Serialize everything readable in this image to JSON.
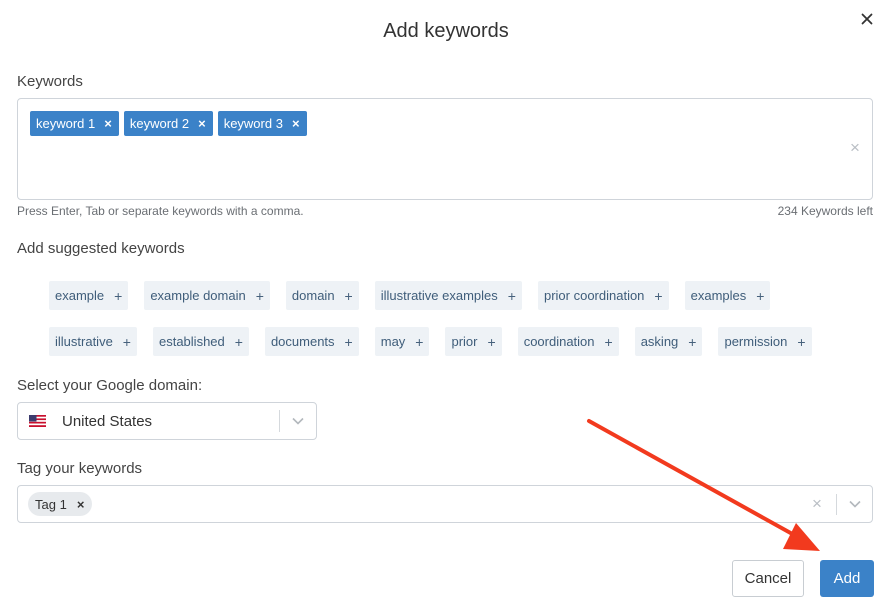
{
  "dialog": {
    "title": "Add keywords",
    "close_icon": "close-icon"
  },
  "keywords": {
    "label": "Keywords",
    "tags": [
      "keyword 1",
      "keyword 2",
      "keyword 3"
    ],
    "remove_glyph": "×",
    "clear_glyph": "×",
    "hint": "Press Enter, Tab or separate keywords with a comma.",
    "left_count": "234 Keywords left",
    "tag_color": "#3b82c8"
  },
  "suggested": {
    "label": "Add suggested keywords",
    "plus_glyph": "+",
    "row1": [
      "example",
      "example domain",
      "domain",
      "illustrative examples",
      "prior coordination",
      "examples"
    ],
    "row2": [
      "illustrative",
      "established",
      "documents",
      "may",
      "prior",
      "coordination",
      "asking",
      "permission"
    ]
  },
  "domain": {
    "label": "Select your Google domain:",
    "selected": "United States",
    "flag_icon": "us-flag-icon"
  },
  "tagging": {
    "label": "Tag your keywords",
    "tags": [
      "Tag 1"
    ],
    "remove_glyph": "×",
    "clear_glyph": "×"
  },
  "actions": {
    "cancel_label": "Cancel",
    "add_label": "Add",
    "primary_color": "#3b82c8"
  },
  "annotation": {
    "arrow_color": "#f23a1e"
  }
}
